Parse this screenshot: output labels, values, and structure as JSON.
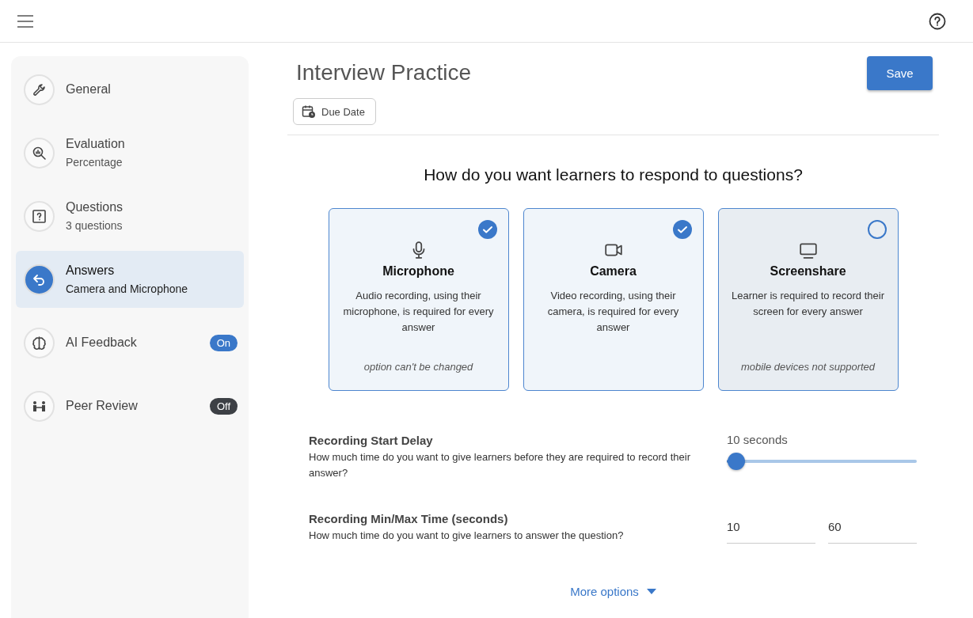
{
  "sidebar": {
    "items": [
      {
        "title": "General",
        "selected": false
      },
      {
        "title": "Evaluation",
        "subtitle": "Percentage",
        "selected": false
      },
      {
        "title": "Questions",
        "subtitle": "3 questions",
        "selected": false
      },
      {
        "title": "Answers",
        "subtitle": "Camera and Microphone",
        "selected": true
      },
      {
        "title": "AI Feedback",
        "selected": false,
        "toggle": {
          "text": "On",
          "on": true
        }
      },
      {
        "title": "Peer Review",
        "selected": false,
        "toggle": {
          "text": "Off",
          "on": false
        }
      }
    ]
  },
  "header": {
    "title": "Interview Practice",
    "save": "Save",
    "due_date": "Due Date"
  },
  "question": "How do you want learners to respond to questions?",
  "options": [
    {
      "title": "Microphone",
      "description": "Audio recording, using their microphone, is required for every answer",
      "note": "option can't be changed",
      "checked": true
    },
    {
      "title": "Camera",
      "description": "Video recording, using their camera, is required for every answer",
      "checked": true
    },
    {
      "title": "Screenshare",
      "description": "Learner is required to record their screen for every answer",
      "note": "mobile devices not supported",
      "checked": false
    }
  ],
  "start_delay": {
    "title": "Recording Start Delay",
    "description": "How much time do you want to give learners before they are required to record their answer?",
    "reading": "10 seconds",
    "level": 0.05
  },
  "min_max": {
    "title": "Recording Min/Max Time (seconds)",
    "description": "How much time do you want to give learners to answer the question?",
    "min": "10",
    "max": "60"
  },
  "more_options": "More options"
}
